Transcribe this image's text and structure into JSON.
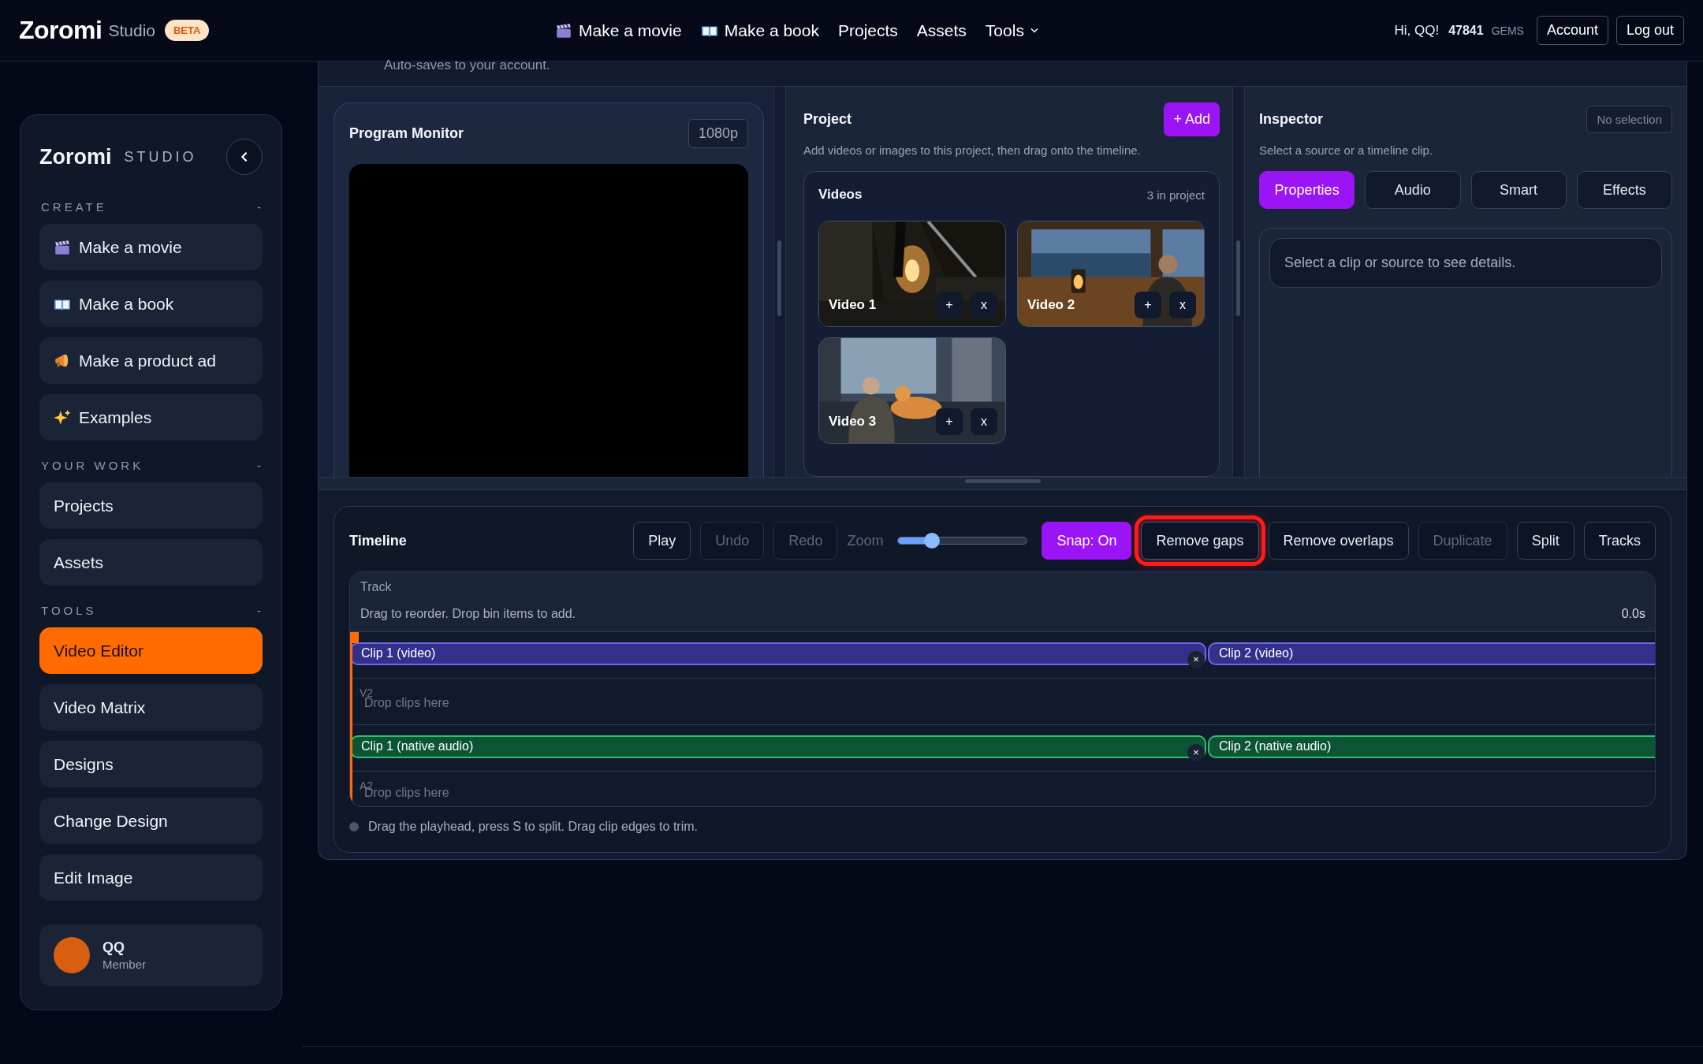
{
  "header": {
    "logo": "Zoromi",
    "logo_sub": "Studio",
    "badge": "BETA",
    "nav": [
      {
        "label": "Make a movie",
        "dropdown": false
      },
      {
        "label": "Make a book",
        "dropdown": false
      },
      {
        "label": "Projects",
        "dropdown": false
      },
      {
        "label": "Assets",
        "dropdown": false
      },
      {
        "label": "Tools",
        "dropdown": true
      }
    ],
    "greeting": "Hi, QQ!",
    "gems": "47841",
    "gems_unit": "GEMS",
    "buttons": [
      "Account",
      "Log out"
    ]
  },
  "sidebar": {
    "brand": "Zoromi",
    "brand_sub": "STUDIO",
    "sections": [
      {
        "title": "CREATE",
        "toggle": "-",
        "items": [
          {
            "label": "Make a movie",
            "selected": false
          },
          {
            "label": "Make a book",
            "selected": false
          },
          {
            "label": "Make a product ad",
            "selected": false
          },
          {
            "label": "Examples",
            "selected": false
          }
        ]
      },
      {
        "title": "YOUR WORK",
        "toggle": "-",
        "items": [
          {
            "label": "Projects",
            "selected": false
          },
          {
            "label": "Assets",
            "selected": false
          }
        ]
      },
      {
        "title": "TOOLS",
        "toggle": "-",
        "items": [
          {
            "label": "Video Editor",
            "selected": true
          },
          {
            "label": "Video Matrix",
            "selected": false
          },
          {
            "label": "Designs",
            "selected": false
          },
          {
            "label": "Change Design",
            "selected": false
          },
          {
            "label": "Edit Image",
            "selected": false
          }
        ]
      }
    ],
    "user": {
      "name": "QQ",
      "role": "Member"
    }
  },
  "autosave_note": "Auto-saves to your account.",
  "monitor": {
    "title": "Program Monitor",
    "resolution": "1080p"
  },
  "project": {
    "title": "Project",
    "add_button": "+ Add",
    "hint": "Add videos or images to this project, then drag onto the timeline.",
    "bin": {
      "title": "Videos",
      "count": "3 in project",
      "items": [
        {
          "label": "Video 1",
          "add": "+",
          "remove": "x",
          "kind": "picture"
        },
        {
          "label": "Video 2",
          "add": "+",
          "remove": "x",
          "kind": "picture"
        },
        {
          "label": "Video 3",
          "add": "+",
          "remove": "x",
          "kind": "picture"
        }
      ]
    }
  },
  "inspector": {
    "title": "Inspector",
    "status": "No selection",
    "hint": "Select a source or a timeline clip.",
    "tabs": [
      {
        "label": "Properties",
        "selected": true
      },
      {
        "label": "Audio",
        "selected": false
      },
      {
        "label": "Smart",
        "selected": false
      },
      {
        "label": "Effects",
        "selected": false
      }
    ],
    "empty": "Select a clip or source to see details."
  },
  "timeline": {
    "title": "Timeline",
    "buttons": [
      {
        "label": "Play",
        "disabled": false
      },
      {
        "label": "Undo",
        "disabled": true
      },
      {
        "label": "Redo",
        "disabled": true
      }
    ],
    "zoom": {
      "label": "Zoom",
      "level": 0.23
    },
    "tools": [
      {
        "label": "Snap: On",
        "on": true,
        "disabled": false,
        "highlighted": false
      },
      {
        "label": "Remove gaps",
        "on": false,
        "disabled": false,
        "highlighted": true
      },
      {
        "label": "Remove overlaps",
        "on": false,
        "disabled": false,
        "highlighted": false
      },
      {
        "label": "Duplicate",
        "on": false,
        "disabled": true,
        "highlighted": false
      },
      {
        "label": "Split",
        "on": false,
        "disabled": false,
        "highlighted": false
      },
      {
        "label": "Tracks",
        "on": false,
        "disabled": false,
        "highlighted": false
      }
    ],
    "track_header": "Track",
    "track_hint": "Drag to reorder. Drop bin items to add.",
    "time": "0.0s",
    "tracks": [
      {
        "kind": "video",
        "clips": [
          {
            "label": "Clip 1 (video)",
            "remove": "×"
          },
          {
            "label": "Clip 2 (video)"
          }
        ]
      },
      {
        "kind": "video",
        "name": "V2",
        "placeholder": "Drop clips here"
      },
      {
        "kind": "audio",
        "clips": [
          {
            "label": "Clip 1 (native audio)",
            "remove": "×"
          },
          {
            "label": "Clip 2 (native audio)"
          }
        ]
      },
      {
        "kind": "audio",
        "name": "A2",
        "placeholder": "Drop clips here"
      }
    ],
    "footer": "Drag the playhead, press S to split. Drag clip edges to trim."
  }
}
